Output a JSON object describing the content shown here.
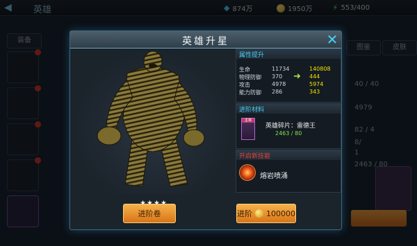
{
  "background": {
    "back_glyph": "◀",
    "title": "英雄",
    "gem_value": "874万",
    "gold_value": "1950万",
    "energy_value": "553/400",
    "left_tab": "装备",
    "right_tabs": [
      "图鉴",
      "皮肤"
    ],
    "stat_lines": [
      "40 / 40",
      "4979",
      "82 / 4",
      "8/",
      "1",
      "2463 / 80"
    ]
  },
  "modal": {
    "title": "英雄升星",
    "close_glyph": "✕",
    "stars": "★★★★",
    "advance_scroll_label": "进阶卷",
    "advance_label": "进阶",
    "advance_cost": "100000"
  },
  "attributes": {
    "title": "属性提升",
    "arrow_glyph": "➜",
    "rows": [
      {
        "label": "生命",
        "current": "11734",
        "next": "140808"
      },
      {
        "label": "物理防御",
        "current": "370",
        "next": "444"
      },
      {
        "label": "攻击",
        "current": "4978",
        "next": "5974"
      },
      {
        "label": "能力防御",
        "current": "286",
        "next": "343"
      }
    ]
  },
  "materials": {
    "title": "进阶材料",
    "item_tag": "主将",
    "item_name": "英雄碎片：雷德王",
    "item_count": "2463 / 80"
  },
  "skill": {
    "title": "开启新技能",
    "name": "熔岩喷涌"
  },
  "colors": {
    "accent_cyan": "#4ad0f5",
    "yellow_value": "#f2e200",
    "green_value": "#8de04a",
    "red_title": "#e0463a",
    "orange_button": "#e8891e"
  }
}
